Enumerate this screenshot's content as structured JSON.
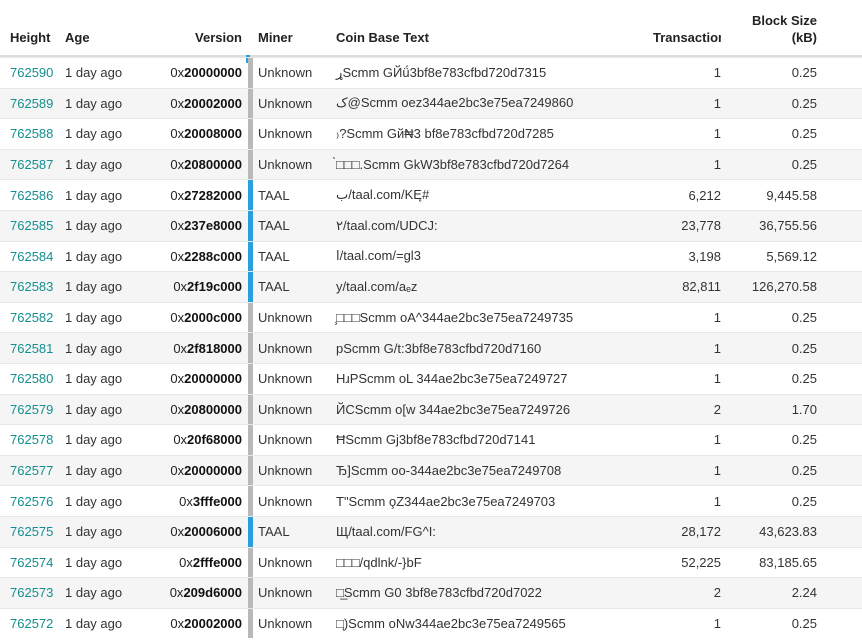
{
  "columns": {
    "height": "Height",
    "age": "Age",
    "version": "Version",
    "miner": "Miner",
    "coinbase": "Coin Base Text",
    "transactions": "Transactions",
    "block_size_line1": "Block Size",
    "block_size_line2": "(kB)"
  },
  "colors": {
    "link": "#148f8f",
    "taal_bar": "#2a9fdd",
    "default_bar": "#b9b9b9",
    "stripe": "#f5f5f5"
  },
  "rows": [
    {
      "height": "762590",
      "age": "1 day ago",
      "version_prefix": "0x",
      "version_bold": "20000000",
      "miner": "Unknown",
      "coinbase": "ړScmm   GЙǘ3bf8e783cfbd720d7315",
      "transactions": "1",
      "size": "0.25",
      "taal": false
    },
    {
      "height": "762589",
      "age": "1 day ago",
      "version_prefix": "0x",
      "version_bold": "20002000",
      "miner": "Unknown",
      "coinbase": "ک@Scmm   oez344ae2bc3e75ea7249860",
      "transactions": "1",
      "size": "0.25",
      "taal": false
    },
    {
      "height": "762588",
      "age": "1 day ago",
      "version_prefix": "0x",
      "version_bold": "20008000",
      "miner": "Unknown",
      "coinbase": "₎?Scmm   Gй₦3 bf8e783cfbd720d7285",
      "transactions": "1",
      "size": "0.25",
      "taal": false
    },
    {
      "height": "762587",
      "age": "1 day ago",
      "version_prefix": "0x",
      "version_bold": "20800000",
      "miner": "Unknown",
      "coinbase": "̀□□□.Scmm   GkW3bf8e783cfbd720d7264",
      "transactions": "1",
      "size": "0.25",
      "taal": false
    },
    {
      "height": "762586",
      "age": "1 day ago",
      "version_prefix": "0x",
      "version_bold": "27282000",
      "miner": "TAAL",
      "coinbase": "ب/taal.com/KĘ#",
      "transactions": "6,212",
      "size": "9,445.58",
      "taal": true
    },
    {
      "height": "762585",
      "age": "1 day ago",
      "version_prefix": "0x",
      "version_bold": "237e8000",
      "miner": "TAAL",
      "coinbase": "٢/taal.com/UDCJ:",
      "transactions": "23,778",
      "size": "36,755.56",
      "taal": true
    },
    {
      "height": "762584",
      "age": "1 day ago",
      "version_prefix": "0x",
      "version_bold": "2288c000",
      "miner": "TAAL",
      "coinbase": "ا/taal.com/=gl3",
      "transactions": "3,198",
      "size": "5,569.12",
      "taal": true
    },
    {
      "height": "762583",
      "age": "1 day ago",
      "version_prefix": "0x",
      "version_bold": "2f19c000",
      "miner": "TAAL",
      "coinbase": "у/taal.com/aₑz",
      "transactions": "82,811",
      "size": "126,270.58",
      "taal": true
    },
    {
      "height": "762582",
      "age": "1 day ago",
      "version_prefix": "0x",
      "version_bold": "2000c000",
      "miner": "Unknown",
      "coinbase": "̧□□□Scmm   oA^344ae2bc3e75ea7249735",
      "transactions": "1",
      "size": "0.25",
      "taal": false
    },
    {
      "height": "762581",
      "age": "1 day ago",
      "version_prefix": "0x",
      "version_bold": "2f818000",
      "miner": "Unknown",
      "coinbase": "pScmm   G/t:3bf8e783cfbd720d7160",
      "transactions": "1",
      "size": "0.25",
      "taal": false
    },
    {
      "height": "762580",
      "age": "1 day ago",
      "version_prefix": "0x",
      "version_bold": "20000000",
      "miner": "Unknown",
      "coinbase": "HɹPScmm   oL   344ae2bc3e75ea7249727",
      "transactions": "1",
      "size": "0.25",
      "taal": false
    },
    {
      "height": "762579",
      "age": "1 day ago",
      "version_prefix": "0x",
      "version_bold": "20800000",
      "miner": "Unknown",
      "coinbase": "ЙCScmm   o[w   344ae2bc3e75ea7249726",
      "transactions": "2",
      "size": "1.70",
      "taal": false
    },
    {
      "height": "762578",
      "age": "1 day ago",
      "version_prefix": "0x",
      "version_bold": "20f68000",
      "miner": "Unknown",
      "coinbase": "ĦScmm   Gj3bf8e783cfbd720d7141",
      "transactions": "1",
      "size": "0.25",
      "taal": false
    },
    {
      "height": "762577",
      "age": "1 day ago",
      "version_prefix": "0x",
      "version_bold": "20000000",
      "miner": "Unknown",
      "coinbase": "Ђ]Scmm   oo-344ae2bc3e75ea7249708",
      "transactions": "1",
      "size": "0.25",
      "taal": false
    },
    {
      "height": "762576",
      "age": "1 day ago",
      "version_prefix": "0x",
      "version_bold": "3fffe000",
      "miner": "Unknown",
      "coinbase": "T\"Scmm   o̧Z344ae2bc3e75ea7249703",
      "transactions": "1",
      "size": "0.25",
      "taal": false
    },
    {
      "height": "762575",
      "age": "1 day ago",
      "version_prefix": "0x",
      "version_bold": "20006000",
      "miner": "TAAL",
      "coinbase": "Щ/taal.com/FG^I:",
      "transactions": "28,172",
      "size": "43,623.83",
      "taal": true
    },
    {
      "height": "762574",
      "age": "1 day ago",
      "version_prefix": "0x",
      "version_bold": "2fffe000",
      "miner": "Unknown",
      "coinbase": "□□□/qdlnk/-}bF",
      "transactions": "52,225",
      "size": "83,185.65",
      "taal": false
    },
    {
      "height": "762573",
      "age": "1 day ago",
      "version_prefix": "0x",
      "version_bold": "209d6000",
      "miner": "Unknown",
      "coinbase": "□̲Scmm   G0   3bf8e783cfbd720d7022",
      "transactions": "2",
      "size": "2.24",
      "taal": false
    },
    {
      "height": "762572",
      "age": "1 day ago",
      "version_prefix": "0x",
      "version_bold": "20002000",
      "miner": "Unknown",
      "coinbase": "□̨)Scmm   oNw344ae2bc3e75ea7249565",
      "transactions": "1",
      "size": "0.25",
      "taal": false
    }
  ]
}
